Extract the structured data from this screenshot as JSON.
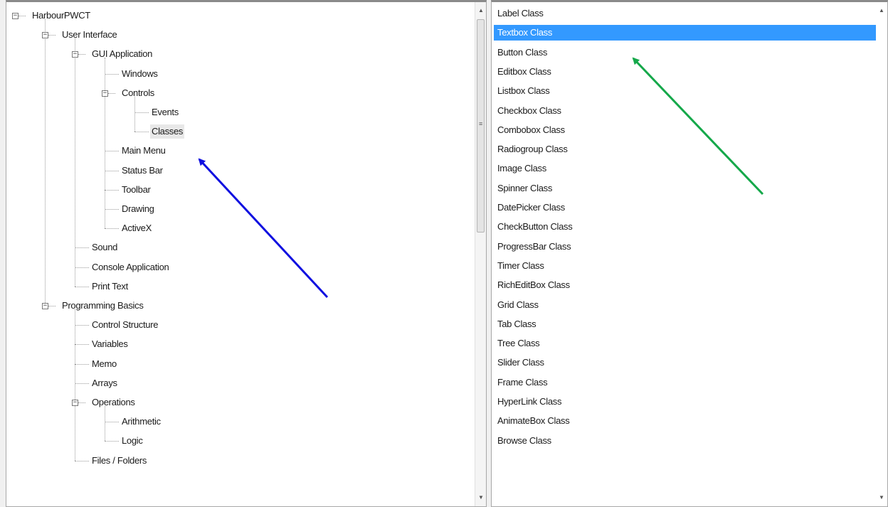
{
  "tree": {
    "nodes": [
      {
        "label": "HarbourPWCT",
        "level": 0,
        "expanded": true
      },
      {
        "label": "User Interface",
        "level": 1,
        "expanded": true
      },
      {
        "label": "GUI Application",
        "level": 2,
        "expanded": true
      },
      {
        "label": "Windows",
        "level": 3
      },
      {
        "label": "Controls",
        "level": 3,
        "expanded": true
      },
      {
        "label": "Events",
        "level": 4
      },
      {
        "label": "Classes",
        "level": 4,
        "selected": true
      },
      {
        "label": "Main Menu",
        "level": 3
      },
      {
        "label": "Status Bar",
        "level": 3
      },
      {
        "label": "Toolbar",
        "level": 3
      },
      {
        "label": "Drawing",
        "level": 3
      },
      {
        "label": "ActiveX",
        "level": 3
      },
      {
        "label": "Sound",
        "level": 2
      },
      {
        "label": "Console Application",
        "level": 2
      },
      {
        "label": "Print Text",
        "level": 2
      },
      {
        "label": "Programming Basics",
        "level": 1,
        "expanded": true
      },
      {
        "label": "Control Structure",
        "level": 2
      },
      {
        "label": "Variables",
        "level": 2
      },
      {
        "label": "Memo",
        "level": 2
      },
      {
        "label": "Arrays",
        "level": 2
      },
      {
        "label": "Operations",
        "level": 2,
        "expanded": true
      },
      {
        "label": "Arithmetic",
        "level": 3
      },
      {
        "label": "Logic",
        "level": 3
      },
      {
        "label": "Files / Folders",
        "level": 2
      }
    ]
  },
  "classes": {
    "selected_index": 1,
    "items": [
      "Label Class",
      "Textbox Class",
      "Button Class",
      "Editbox Class",
      "Listbox Class",
      "Checkbox Class",
      "Combobox Class",
      "Radiogroup Class",
      "Image Class",
      "Spinner Class",
      "DatePicker Class",
      "CheckButton Class",
      "ProgressBar Class",
      "Timer Class",
      "RichEditBox Class",
      "Grid Class",
      "Tab Class",
      "Tree Class",
      "Slider Class",
      "Frame Class",
      "HyperLink Class",
      "AnimateBox Class",
      "Browse Class"
    ]
  },
  "icons": {
    "collapse": "minus-box-icon",
    "scroll_up": "arrow-up-icon",
    "scroll_down": "arrow-down-icon"
  },
  "colors": {
    "selection": "#3399ff",
    "annotation_blue": "#1010e0",
    "annotation_green": "#15a84a"
  }
}
